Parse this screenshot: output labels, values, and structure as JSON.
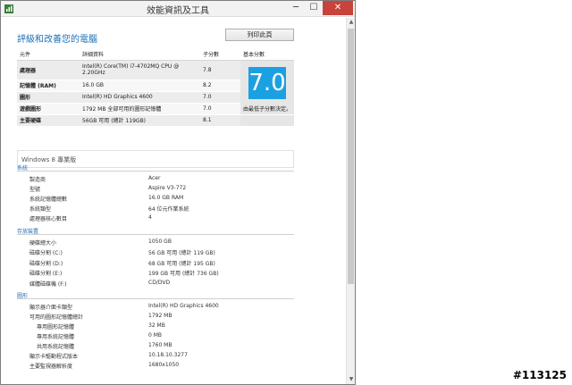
{
  "window": {
    "title": "效能資訊及工具",
    "min": "─",
    "max": "☐",
    "close": "✕"
  },
  "heading": "評級和改善您的電腦",
  "print_button": "列印此頁",
  "score_table": {
    "headers": [
      "元件",
      "詳細資料",
      "子分數",
      "基本分數"
    ],
    "rows": [
      {
        "component": "處理器",
        "detail": "Intel(R) Core(TM) i7-4702MQ CPU @ 2.20GHz",
        "score": "7.8"
      },
      {
        "component": "記憶體 (RAM)",
        "detail": "16.0 GB",
        "score": "8.2"
      },
      {
        "component": "圖形",
        "detail": "Intel(R) HD Graphics 4600",
        "score": "7.0"
      },
      {
        "component": "遊戲圖形",
        "detail": "1792 MB 全部可用的圖形記憶體",
        "score": "7.0"
      },
      {
        "component": "主要硬碟",
        "detail": "56GB 可用 (總計 119GB)",
        "score": "8.1"
      }
    ],
    "base_score": "7.0",
    "base_note": "由最低子分數決定。"
  },
  "edition": "Windows 8 專業版",
  "sections": [
    {
      "title": "系統",
      "rows": [
        {
          "label": "製造商",
          "value": "Acer"
        },
        {
          "label": "型號",
          "value": "Aspire V3-772"
        },
        {
          "label": "系統記憶體總數",
          "value": "16.0 GB RAM"
        },
        {
          "label": "系統類型",
          "value": "64 位元作業系統"
        },
        {
          "label": "處理器核心數目",
          "value": "4"
        }
      ]
    },
    {
      "title": "存放裝置",
      "rows": [
        {
          "label": "硬碟總大小",
          "value": "1050 GB"
        },
        {
          "label": "磁碟分割 (C:)",
          "value": "56 GB 可用 (總計 119 GB)"
        },
        {
          "label": "磁碟分割 (D:)",
          "value": "68 GB 可用 (總計 195 GB)"
        },
        {
          "label": "磁碟分割 (E:)",
          "value": "199 GB 可用 (總計 736 GB)"
        },
        {
          "label": "媒體磁碟機 (F:)",
          "value": "CD/DVD"
        }
      ]
    },
    {
      "title": "圖形",
      "rows": [
        {
          "label": "顯示器介面卡類型",
          "value": "Intel(R) HD Graphics 4600"
        },
        {
          "label": "可用的圖形記憶體總計",
          "value": "1792 MB"
        },
        {
          "label": "專用圖形記憶體",
          "value": "32 MB",
          "indent": true
        },
        {
          "label": "專用系統記憶體",
          "value": "0 MB",
          "indent": true
        },
        {
          "label": "共用系統記憶體",
          "value": "1760 MB",
          "indent": true
        },
        {
          "label": "顯示卡驅動程式版本",
          "value": "10.18.10.3277"
        },
        {
          "label": "主要監視器解析度",
          "value": "1680x1050"
        }
      ]
    }
  ],
  "watermark": "#113125"
}
